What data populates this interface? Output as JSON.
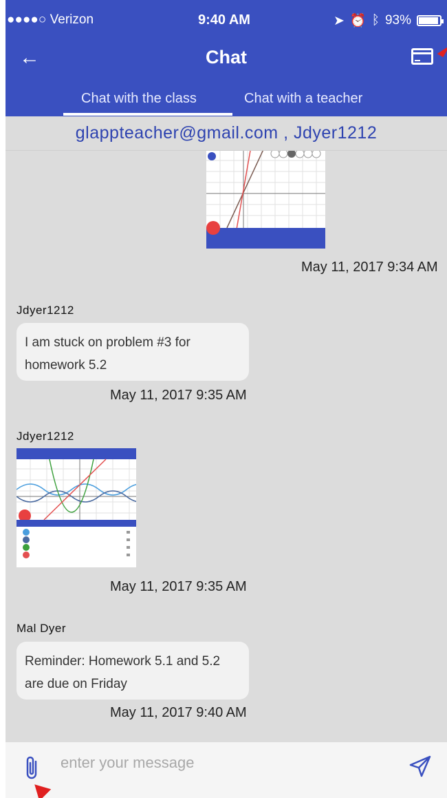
{
  "status_bar": {
    "carrier": "●●●●○ Verizon",
    "time": "9:40 AM",
    "battery": "93%"
  },
  "header": {
    "title": "Chat"
  },
  "tabs": [
    {
      "label": "Chat with the class",
      "active": true
    },
    {
      "label": "Chat with a teacher",
      "active": false
    }
  ],
  "participants": "glappteacher@gmail.com , Jdyer1212",
  "messages": [
    {
      "type": "image",
      "timestamp": "May 11, 2017 9:34 AM"
    },
    {
      "type": "text",
      "sender": "Jdyer1212",
      "text": "I am stuck on problem #3 for homework 5.2",
      "timestamp": "May 11, 2017 9:35 AM"
    },
    {
      "type": "image",
      "sender": "Jdyer1212",
      "timestamp": "May 11, 2017 9:35 AM"
    },
    {
      "type": "text",
      "sender": "Mal Dyer",
      "text": "Reminder: Homework 5.1 and 5.2 are due on Friday",
      "timestamp": "May 11, 2017 9:40 AM"
    }
  ],
  "composer": {
    "placeholder": "enter your message"
  },
  "colors": {
    "header_blue": "#3a50c0",
    "participants_text": "#2e43b0",
    "annotation_red": "#e02020"
  },
  "icons": [
    "back-arrow-icon",
    "credit-card-icon",
    "paperclip-icon",
    "send-icon"
  ]
}
